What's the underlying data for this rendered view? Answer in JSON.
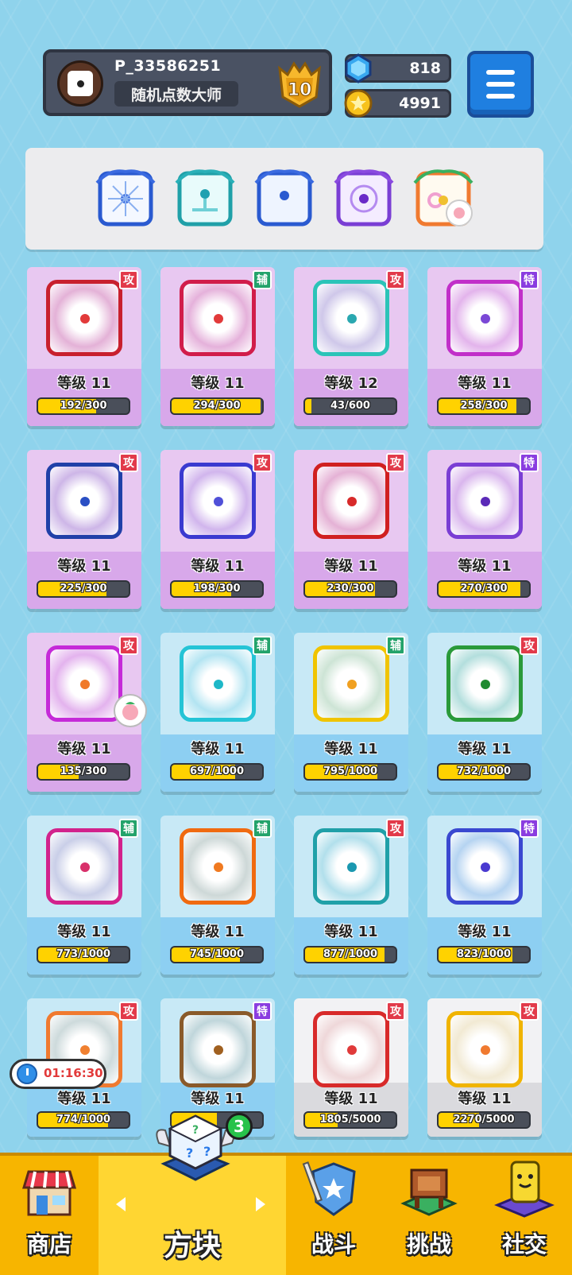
{
  "player": {
    "id": "P_33586251",
    "title": "随机点数大师",
    "rank": "10"
  },
  "currency": {
    "gems": "818",
    "coins": "4991"
  },
  "colors": {
    "attack_tag": "#e23a4a",
    "support_tag": "#23a36b",
    "special_tag": "#8a3de0",
    "bar_fill": "#ffd200"
  },
  "deck": [
    "snow-dice",
    "wind-dice",
    "moon-dice",
    "nebula-dice",
    "rainbow-dice"
  ],
  "cards": [
    {
      "tag": "攻",
      "tag_type": "attack",
      "level": "等级 11",
      "progress": "192/300",
      "ratio": 0.64,
      "tier": "purple",
      "border": "#c8202e",
      "pip": "#e23a3a",
      "icon": "lightning-dice-icon"
    },
    {
      "tag": "辅",
      "tag_type": "support",
      "level": "等级 11",
      "progress": "294/300",
      "ratio": 0.98,
      "tier": "purple",
      "border": "#d11d4a",
      "pip": "#e23a3a",
      "icon": "cross-dice-icon"
    },
    {
      "tag": "攻",
      "tag_type": "attack",
      "level": "等级 12",
      "progress": "43/600",
      "ratio": 0.07,
      "tier": "purple",
      "border": "#2bc4b8",
      "pip": "#2aa8b0",
      "icon": "wind-dice-icon"
    },
    {
      "tag": "特",
      "tag_type": "special",
      "level": "等级 11",
      "progress": "258/300",
      "ratio": 0.86,
      "tier": "purple",
      "border": "#c12fc9",
      "pip": "#7b48d6",
      "icon": "swap-dice-icon"
    },
    {
      "tag": "攻",
      "tag_type": "attack",
      "level": "等级 11",
      "progress": "225/300",
      "ratio": 0.75,
      "tier": "purple",
      "border": "#2040a8",
      "pip": "#2a4fc4",
      "icon": "gear-dice-icon"
    },
    {
      "tag": "攻",
      "tag_type": "attack",
      "level": "等级 11",
      "progress": "198/300",
      "ratio": 0.66,
      "tier": "purple",
      "border": "#3a3ad0",
      "pip": "#5050d8",
      "icon": "gravity-dice-icon"
    },
    {
      "tag": "攻",
      "tag_type": "attack",
      "level": "等级 11",
      "progress": "230/300",
      "ratio": 0.77,
      "tier": "purple",
      "border": "#d02020",
      "pip": "#d82a2a",
      "icon": "fire-dice-icon"
    },
    {
      "tag": "特",
      "tag_type": "special",
      "level": "等级 11",
      "progress": "270/300",
      "ratio": 0.9,
      "tier": "purple",
      "border": "#7a3ed4",
      "pip": "#5b2ab8",
      "icon": "crack-dice-icon"
    },
    {
      "tag": "攻",
      "tag_type": "attack",
      "level": "等级 11",
      "progress": "135/300",
      "ratio": 0.45,
      "tier": "purple",
      "border": "#c52ad8",
      "pip": "#f07a2a",
      "icon": "sun-dice-icon"
    },
    {
      "tag": "辅",
      "tag_type": "support",
      "level": "等级 11",
      "progress": "697/1000",
      "ratio": 0.7,
      "tier": "blue",
      "border": "#25c4d6",
      "pip": "#1eb8c8",
      "icon": "plus-dice-icon"
    },
    {
      "tag": "辅",
      "tag_type": "support",
      "level": "等级 11",
      "progress": "795/1000",
      "ratio": 0.8,
      "tier": "blue",
      "border": "#f0c400",
      "pip": "#f0a020",
      "icon": "arrow-up-dice-icon"
    },
    {
      "tag": "攻",
      "tag_type": "attack",
      "level": "等级 11",
      "progress": "732/1000",
      "ratio": 0.73,
      "tier": "blue",
      "border": "#2a9a3a",
      "pip": "#1f8a30",
      "icon": "thorn-dice-icon"
    },
    {
      "tag": "辅",
      "tag_type": "support",
      "level": "等级 11",
      "progress": "773/1000",
      "ratio": 0.77,
      "tier": "blue",
      "border": "#d2228c",
      "pip": "#d8306a",
      "icon": "shield-dice-icon"
    },
    {
      "tag": "辅",
      "tag_type": "support",
      "level": "等级 11",
      "progress": "745/1000",
      "ratio": 0.75,
      "tier": "blue",
      "border": "#f06a10",
      "pip": "#f07a20",
      "icon": "sword-dice-icon"
    },
    {
      "tag": "攻",
      "tag_type": "attack",
      "level": "等级 11",
      "progress": "877/1000",
      "ratio": 0.88,
      "tier": "blue",
      "border": "#20a0a8",
      "pip": "#1a98b0",
      "icon": "ice-burst-dice-icon"
    },
    {
      "tag": "特",
      "tag_type": "special",
      "level": "等级 11",
      "progress": "823/1000",
      "ratio": 0.82,
      "tier": "blue",
      "border": "#3a48d0",
      "pip": "#4a3ad0",
      "icon": "hands-dice-icon"
    },
    {
      "tag": "攻",
      "tag_type": "attack",
      "level": "等级 11",
      "progress": "774/1000",
      "ratio": 0.77,
      "tier": "blue",
      "border": "#f07a30",
      "pip": "#f08030",
      "icon": "bow-dice-icon"
    },
    {
      "tag": "特",
      "tag_type": "special",
      "level": "等级 11",
      "progress": "",
      "ratio": 0.5,
      "tier": "blue",
      "border": "#8a5a2a",
      "pip": "#a06020",
      "icon": "mystery-dice-icon"
    },
    {
      "tag": "攻",
      "tag_type": "attack",
      "level": "等级 11",
      "progress": "1805/5000",
      "ratio": 0.36,
      "tier": "white",
      "border": "#d82a2a",
      "pip": "#e03a3a",
      "icon": "blast-dice-icon"
    },
    {
      "tag": "攻",
      "tag_type": "attack",
      "level": "等级 11",
      "progress": "2270/5000",
      "ratio": 0.45,
      "tier": "white",
      "border": "#f0b400",
      "pip": "#f07a30",
      "icon": "light-dice-icon"
    }
  ],
  "timer": "01:16:30",
  "nav": {
    "shop": "商店",
    "dice": "方块",
    "battle": "战斗",
    "challenge": "挑战",
    "social": "社交",
    "badge": "3"
  }
}
